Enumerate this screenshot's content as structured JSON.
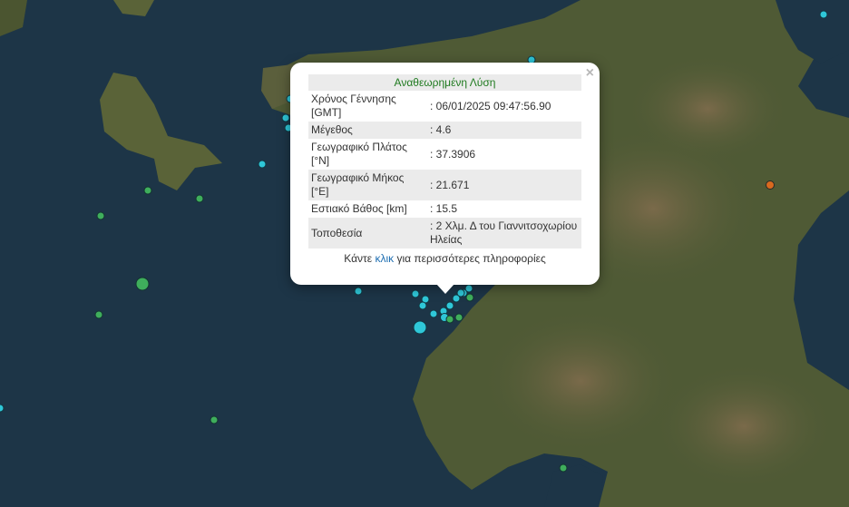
{
  "map": {
    "colors": {
      "sea": "#1d3547",
      "land": "#4f5a35",
      "quake_cyan": "#2fc7d8",
      "quake_green": "#3fae5c",
      "quake_orange": "#d8691f"
    },
    "quakes": [
      {
        "color": "cyan"
      },
      {
        "color": "cyan"
      },
      {
        "color": "cyan"
      },
      {
        "color": "cyan"
      },
      {
        "color": "cyan"
      },
      {
        "color": "cyan"
      },
      {
        "color": "cyan"
      },
      {
        "color": "cyan"
      },
      {
        "color": "cyan"
      },
      {
        "color": "cyan"
      },
      {
        "color": "cyan"
      },
      {
        "color": "cyan"
      },
      {
        "color": "cyan"
      },
      {
        "color": "cyan"
      },
      {
        "color": "cyan"
      },
      {
        "color": "cyan"
      },
      {
        "color": "cyan"
      },
      {
        "color": "cyan"
      },
      {
        "color": "cyan"
      },
      {
        "color": "cyan"
      },
      {
        "color": "green"
      },
      {
        "color": "green"
      },
      {
        "color": "green"
      },
      {
        "color": "green"
      },
      {
        "color": "green"
      },
      {
        "color": "green"
      },
      {
        "color": "green"
      },
      {
        "color": "green"
      },
      {
        "color": "green"
      },
      {
        "color": "green"
      },
      {
        "color": "orange"
      }
    ]
  },
  "popup": {
    "close_label": "×",
    "title": "Αναθεωρημένη Λύση",
    "rows": [
      {
        "label": "Χρόνος Γέννησης [GMT]",
        "value": ": 06/01/2025 09:47:56.90"
      },
      {
        "label": "Μέγεθος",
        "value": ": 4.6"
      },
      {
        "label": "Γεωγραφικό Πλάτος [°N]",
        "value": ": 37.3906"
      },
      {
        "label": "Γεωγραφικό Μήκος [°E]",
        "value": ": 21.671"
      },
      {
        "label": "Εστιακό Βάθος [km]",
        "value": ": 15.5"
      },
      {
        "label": "Τοποθεσία",
        "value": ": 2 Χλμ. Δ του Γιαννιτσοχωρίου Ηλείας"
      }
    ],
    "more_prefix": "Κάντε ",
    "more_link": "κλικ",
    "more_suffix": " για περισσότερες πληροφορίες"
  }
}
